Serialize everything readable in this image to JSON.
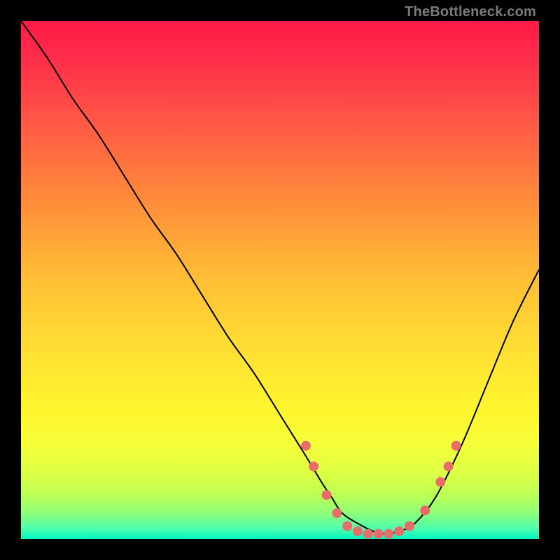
{
  "watermark": "TheBottleneck.com",
  "colors": {
    "point_fill": "#e86d6a",
    "curve_stroke": "#000000",
    "gradient_top": "#ff1a48",
    "gradient_bottom": "#00f5c2",
    "page_bg": "#000000"
  },
  "chart_data": {
    "type": "line",
    "title": "",
    "xlabel": "",
    "ylabel": "",
    "xlim": [
      0,
      100
    ],
    "ylim": [
      0,
      100
    ],
    "grid": false,
    "series": [
      {
        "name": "bottleneck-curve",
        "x": [
          0,
          5,
          10,
          15,
          20,
          25,
          30,
          35,
          40,
          45,
          50,
          55,
          58,
          60,
          62,
          65,
          68,
          70,
          73,
          76,
          80,
          85,
          90,
          95,
          100
        ],
        "y": [
          100,
          93,
          85,
          78,
          70,
          62,
          55,
          47,
          39,
          32,
          24,
          16,
          11,
          8,
          5,
          3,
          1.5,
          1,
          1.5,
          3,
          8,
          18,
          30,
          42,
          52
        ]
      }
    ],
    "points": [
      {
        "x": 55,
        "y": 18
      },
      {
        "x": 56.5,
        "y": 14
      },
      {
        "x": 59,
        "y": 8.5
      },
      {
        "x": 61,
        "y": 5
      },
      {
        "x": 63,
        "y": 2.5
      },
      {
        "x": 65,
        "y": 1.5
      },
      {
        "x": 67,
        "y": 1
      },
      {
        "x": 69,
        "y": 1
      },
      {
        "x": 71,
        "y": 1
      },
      {
        "x": 73,
        "y": 1.5
      },
      {
        "x": 75,
        "y": 2.5
      },
      {
        "x": 78,
        "y": 5.5
      },
      {
        "x": 81,
        "y": 11
      },
      {
        "x": 82.5,
        "y": 14
      },
      {
        "x": 84,
        "y": 18
      }
    ],
    "point_radius_px": 7
  }
}
